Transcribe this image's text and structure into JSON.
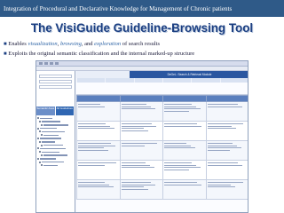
{
  "header": {
    "text": "Integration of Procedural and Declarative  Knowledge for Management of Chronic patients"
  },
  "slide": {
    "title": "The VisiGuide Guideline-Browsing Tool",
    "bullet1": {
      "prefix": "Enables ",
      "term1": "visualization",
      "sep1": ", ",
      "term2": "browsing",
      "sep2": ", and ",
      "term3": "exploration",
      "suffix": " of search results"
    },
    "bullet2": "Exploits the original semantic classification and the internal marked-up structure"
  },
  "screenshot": {
    "left_tabs": [
      "Semantic Axes",
      "All Guidelines"
    ],
    "tree_row_count": 15,
    "banner": "DeGeL: Search & Retrieval Module",
    "nav_count": 6,
    "column_count": 4,
    "row_count": 5
  },
  "colors": {
    "header_bg": "#2f5a88",
    "title": "#1b3f82",
    "highlight": "#2f65a6"
  }
}
